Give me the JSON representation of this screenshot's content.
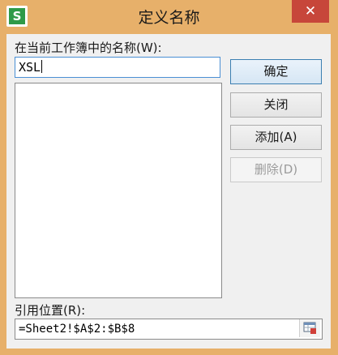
{
  "window": {
    "title": "定义名称",
    "app_icon_glyph": "S",
    "close_glyph": "✕"
  },
  "names_label": "在当前工作簿中的名称(W):",
  "name_input": {
    "value": "XSL"
  },
  "names_list": {
    "items": []
  },
  "buttons": {
    "ok": "确定",
    "close": "关闭",
    "add": "添加(A)",
    "delete": "删除(D)"
  },
  "refers_to": {
    "label": "引用位置(R):",
    "value": "=Sheet2!$A$2:$B$8"
  },
  "icons": {
    "app": "wps-spreadsheet-icon",
    "close": "close-icon",
    "range_select": "range-select-icon"
  },
  "colors": {
    "title_bar": "#e7b06a",
    "close_button": "#c7463a",
    "app_icon": "#2f9a48",
    "input_focus_border": "#4a8fd4"
  }
}
